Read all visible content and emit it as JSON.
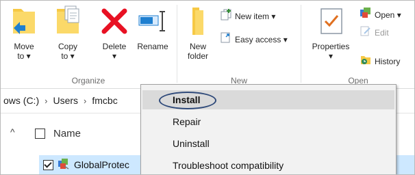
{
  "ribbon": {
    "groups": {
      "organize": {
        "label": "Organize"
      },
      "new": {
        "label": "New"
      },
      "open": {
        "label": "Open"
      }
    },
    "buttons": {
      "move_to": {
        "label": "Move\nto ▾"
      },
      "copy_to": {
        "label": "Copy\nto ▾"
      },
      "delete": {
        "label": "Delete\n▾"
      },
      "rename": {
        "label": "Rename"
      },
      "new_folder": {
        "label": "New\nfolder"
      },
      "new_item": {
        "label": "New item ▾"
      },
      "easy_access": {
        "label": "Easy access ▾"
      },
      "properties": {
        "label": "Properties\n▾"
      },
      "open": {
        "label": "Open ▾"
      },
      "edit": {
        "label": "Edit"
      },
      "history": {
        "label": "History"
      }
    }
  },
  "address": {
    "crumbs": [
      "ows (C:)",
      "Users",
      "fmcbc"
    ],
    "separator": "›"
  },
  "filelist": {
    "column_name": "Name",
    "rows": [
      {
        "name": "GlobalProtec",
        "checked": true
      }
    ]
  },
  "context_menu": {
    "items": [
      {
        "label": "Install",
        "highlighted": true
      },
      {
        "label": "Repair"
      },
      {
        "label": "Uninstall"
      },
      {
        "label": "Troubleshoot compatibility"
      }
    ]
  },
  "colors": {
    "accent_annotation": "#2f4a7a",
    "row_selected": "#cde8ff",
    "menu_bg": "#f2f2f2",
    "menu_highlight": "#dadada",
    "delete_red": "#e81123",
    "folder_yellow": "#f6c945",
    "arrow_blue": "#1e7fd0"
  }
}
